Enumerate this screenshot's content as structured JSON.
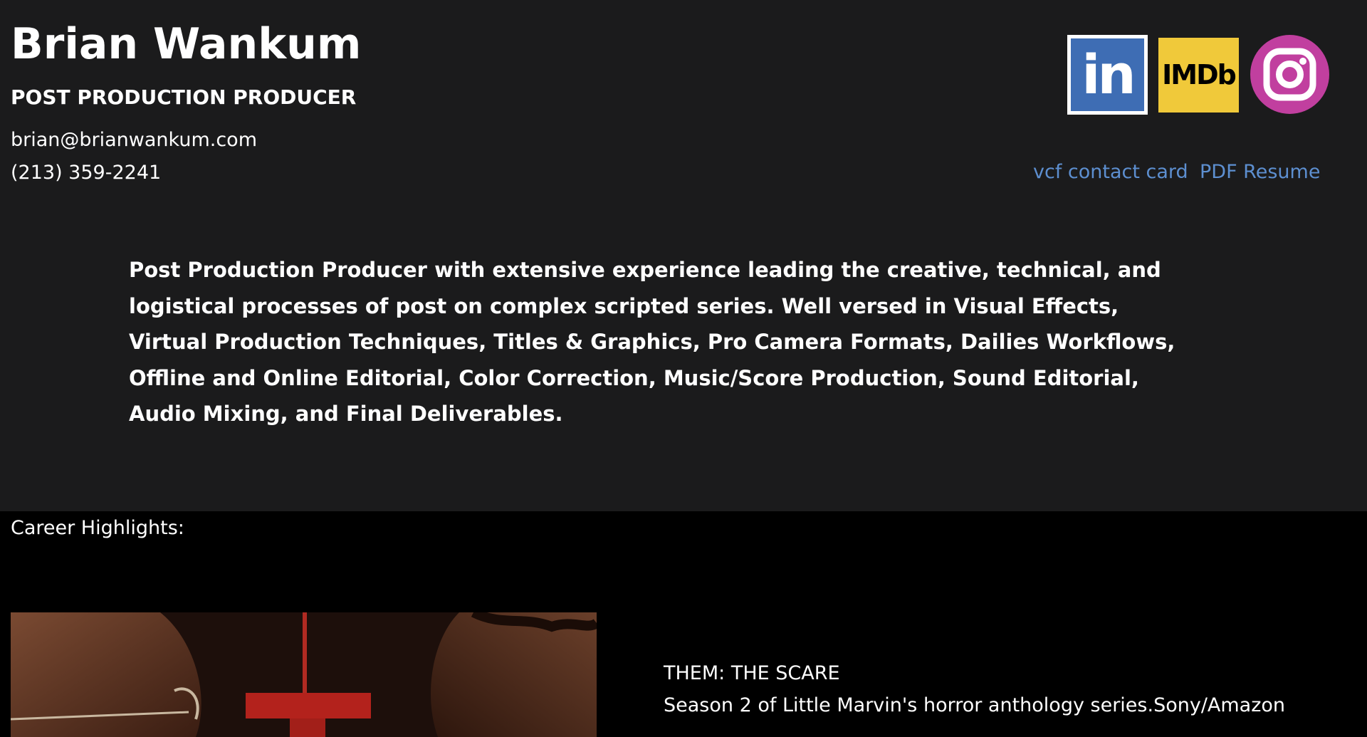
{
  "profile": {
    "name": "Brian Wankum",
    "role": "POST PRODUCTION PRODUCER",
    "email": "brian@brianwankum.com",
    "phone": "(213) 359-2241"
  },
  "social": {
    "linkedin_text": "in",
    "imdb_text": "IMDb",
    "icons": [
      "linkedin-icon",
      "imdb-icon",
      "instagram-icon"
    ]
  },
  "links": {
    "vcf": "vcf contact card",
    "pdf": "PDF Resume"
  },
  "summary": "Post Production Producer with extensive experience leading the creative, technical, and logistical processes of post on complex scripted series.   Well versed in Visual Effects, Virtual Production Techniques, Titles & Graphics, Pro Camera Formats, Dailies Workflows, Offline and Online Editorial, Color Correction, Music/Score Production, Sound Editorial, Audio Mixing, and Final Deliverables.",
  "career": {
    "label": "Career Highlights:",
    "items": [
      {
        "title": "THEM: THE SCARE",
        "description": "Season 2 of Little Marvin's horror anthology series.Sony/Amazon"
      }
    ]
  },
  "colors": {
    "header_bg": "#1b1b1c",
    "page_bg": "#000000",
    "link": "#5d8fd0",
    "linkedin": "#3e6db4",
    "imdb": "#f0c93a",
    "instagram": "#c13f9f"
  }
}
